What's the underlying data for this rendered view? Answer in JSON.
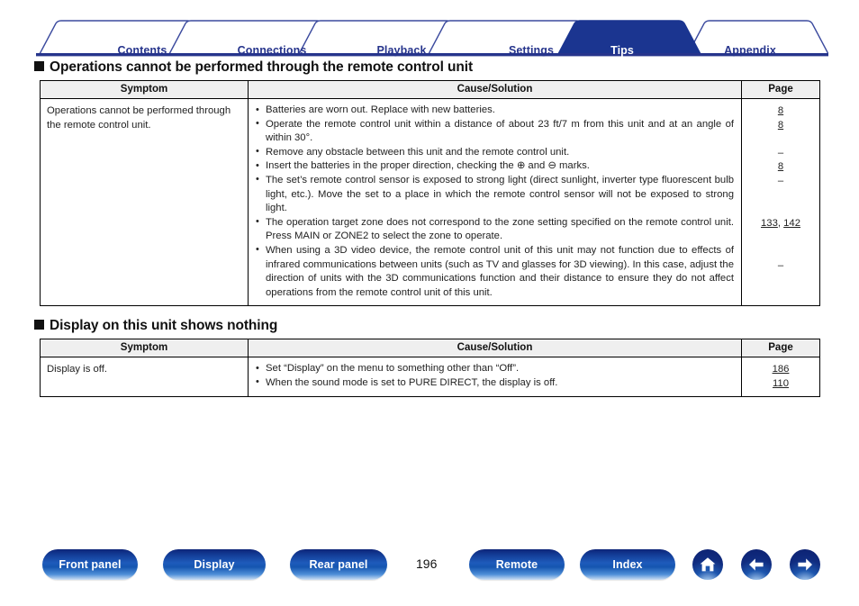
{
  "colors": {
    "tab_active_bg": "#1b3590",
    "tab_text": "#26348c",
    "tab_border": "#3b4a9e",
    "rule": "#26348c",
    "button_blue": "#123a93",
    "text": "#222222"
  },
  "tabs": [
    {
      "label": "Contents",
      "active": false
    },
    {
      "label": "Connections",
      "active": false
    },
    {
      "label": "Playback",
      "active": false
    },
    {
      "label": "Settings",
      "active": false
    },
    {
      "label": "Tips",
      "active": true
    },
    {
      "label": "Appendix",
      "active": false
    }
  ],
  "sections": [
    {
      "heading": "Operations cannot be performed through the remote control unit",
      "columns": [
        "Symptom",
        "Cause/Solution",
        "Page"
      ],
      "rows": [
        {
          "symptom": "Operations cannot be performed through the remote control unit.",
          "causes": [
            "Batteries are worn out. Replace with new batteries.",
            "Operate the remote control unit within a distance of about 23 ft/7 m from this unit and at an angle of within 30°.",
            "Remove any obstacle between this unit and the remote control unit.",
            "Insert the batteries in the proper direction, checking the ⊕ and ⊖ marks.",
            "The set’s remote control sensor is exposed to strong light (direct sunlight, inverter type fluorescent bulb light, etc.). Move the set to a place in which the remote control sensor will not be exposed to strong light.",
            "The operation target zone does not correspond to the zone setting specified on the remote control unit. Press MAIN or ZONE2 to select the zone to operate.",
            "When using a 3D video device, the remote control unit of this unit may not function due to effects of infrared communications between units (such as TV and glasses for 3D viewing). In this case, adjust the direction of units with the 3D communications function and their distance to ensure they do not affect operations from the remote control unit of this unit."
          ],
          "pages": [
            {
              "text": "8",
              "link": true
            },
            {
              "text": "8",
              "link": true
            },
            {
              "text": "–",
              "link": false
            },
            {
              "text": "8",
              "link": true
            },
            {
              "text": "–",
              "link": false
            },
            {
              "text": "133, 142",
              "link": true
            },
            {
              "text": "–",
              "link": false
            }
          ],
          "page_offsets": [
            0,
            1,
            3,
            4,
            5,
            8,
            11
          ]
        }
      ]
    },
    {
      "heading": "Display on this unit shows nothing",
      "columns": [
        "Symptom",
        "Cause/Solution",
        "Page"
      ],
      "rows": [
        {
          "symptom": "Display is off.",
          "causes": [
            "Set “Display” on the menu to something other than “Off”.",
            "When the sound mode is set to PURE DIRECT, the display is off."
          ],
          "pages": [
            {
              "text": "186",
              "link": true
            },
            {
              "text": "110",
              "link": true
            }
          ],
          "page_offsets": [
            0,
            1
          ]
        }
      ]
    }
  ],
  "footer": {
    "buttons": [
      {
        "label": "Front panel",
        "name": "front-panel-button"
      },
      {
        "label": "Display",
        "name": "display-button"
      },
      {
        "label": "Rear panel",
        "name": "rear-panel-button"
      },
      {
        "label": "Remote",
        "name": "remote-button"
      },
      {
        "label": "Index",
        "name": "index-button"
      }
    ],
    "page_number": "196",
    "icons": [
      {
        "name": "home-icon"
      },
      {
        "name": "arrow-left-icon"
      },
      {
        "name": "arrow-right-icon"
      }
    ]
  }
}
